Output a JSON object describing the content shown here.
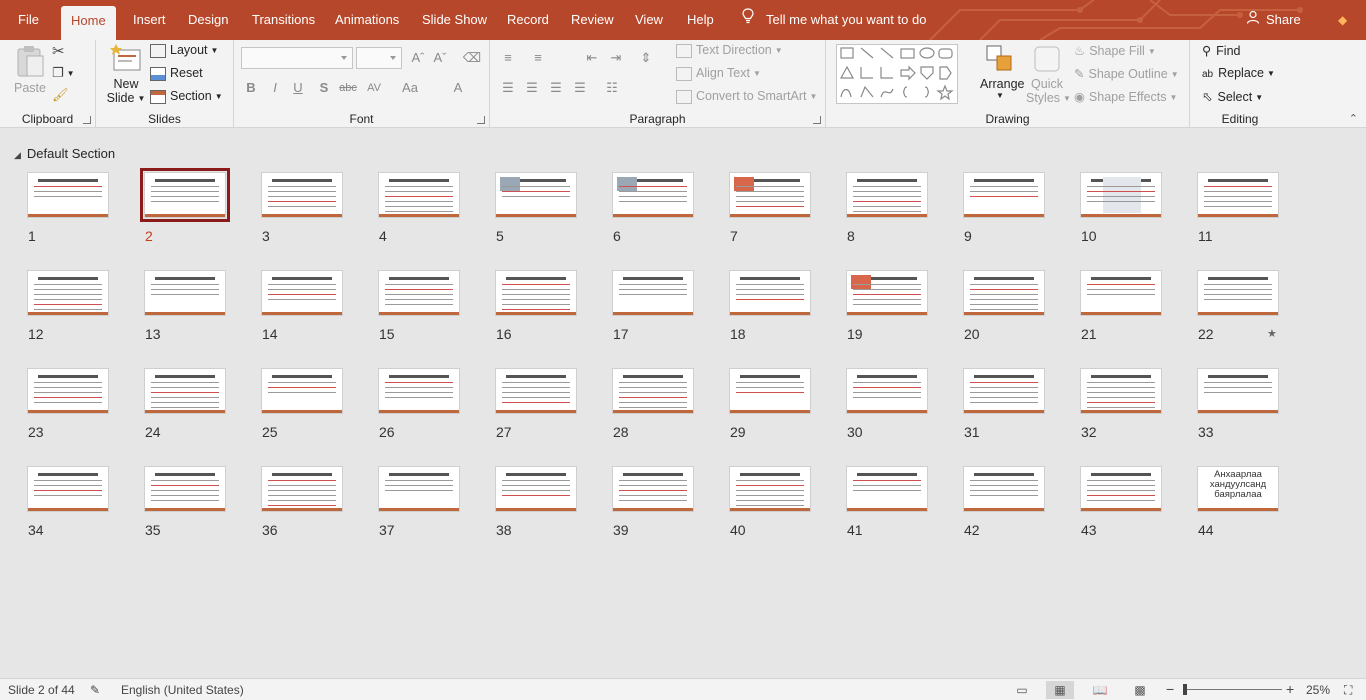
{
  "menu": {
    "tabs": [
      "File",
      "Home",
      "Insert",
      "Design",
      "Transitions",
      "Animations",
      "Slide Show",
      "Record",
      "Review",
      "View",
      "Help"
    ],
    "active": "Home",
    "tell_me": "Tell me what you want to do",
    "share": "Share"
  },
  "ribbon": {
    "clipboard": {
      "paste": "Paste",
      "label": "Clipboard"
    },
    "slides": {
      "new_slide_1": "New",
      "new_slide_2": "Slide",
      "layout": "Layout",
      "reset": "Reset",
      "section": "Section",
      "label": "Slides"
    },
    "font": {
      "label": "Font",
      "bold": "B",
      "italic": "I",
      "underline": "U",
      "shadow": "S",
      "strike": "abc",
      "spacing": "AV",
      "case": "Aa",
      "color": "A"
    },
    "paragraph": {
      "text_direction": "Text Direction",
      "align_text": "Align Text",
      "smartart": "Convert to SmartArt",
      "label": "Paragraph"
    },
    "drawing": {
      "arrange": "Arrange",
      "quick_styles_1": "Quick",
      "quick_styles_2": "Styles",
      "shape_fill": "Shape Fill",
      "shape_outline": "Shape Outline",
      "shape_effects": "Shape Effects",
      "label": "Drawing"
    },
    "editing": {
      "find": "Find",
      "replace": "Replace",
      "select": "Select",
      "label": "Editing"
    }
  },
  "section": {
    "name": "Default Section"
  },
  "slides": [
    {
      "n": "1"
    },
    {
      "n": "2"
    },
    {
      "n": "3"
    },
    {
      "n": "4"
    },
    {
      "n": "5"
    },
    {
      "n": "6"
    },
    {
      "n": "7"
    },
    {
      "n": "8"
    },
    {
      "n": "9"
    },
    {
      "n": "10"
    },
    {
      "n": "11"
    },
    {
      "n": "12"
    },
    {
      "n": "13"
    },
    {
      "n": "14"
    },
    {
      "n": "15"
    },
    {
      "n": "16"
    },
    {
      "n": "17"
    },
    {
      "n": "18"
    },
    {
      "n": "19"
    },
    {
      "n": "20"
    },
    {
      "n": "21"
    },
    {
      "n": "22"
    },
    {
      "n": "23"
    },
    {
      "n": "24"
    },
    {
      "n": "25"
    },
    {
      "n": "26"
    },
    {
      "n": "27"
    },
    {
      "n": "28"
    },
    {
      "n": "29"
    },
    {
      "n": "30"
    },
    {
      "n": "31"
    },
    {
      "n": "32"
    },
    {
      "n": "33"
    },
    {
      "n": "34"
    },
    {
      "n": "35"
    },
    {
      "n": "36"
    },
    {
      "n": "37"
    },
    {
      "n": "38"
    },
    {
      "n": "39"
    },
    {
      "n": "40"
    },
    {
      "n": "41"
    },
    {
      "n": "42"
    },
    {
      "n": "43"
    },
    {
      "n": "44"
    }
  ],
  "selected_slide": "2",
  "slide_44_text": "Анхаарлаа хандуулсанд баярлалаа",
  "status": {
    "slide_of": "Slide 2 of 44",
    "language": "English (United States)",
    "zoom": "25%",
    "zoom_minus": "−",
    "zoom_plus": "+"
  },
  "colors": {
    "accent": "#b7472a",
    "selection": "#8b1a1a",
    "thumb_bar": "#c0683d"
  }
}
